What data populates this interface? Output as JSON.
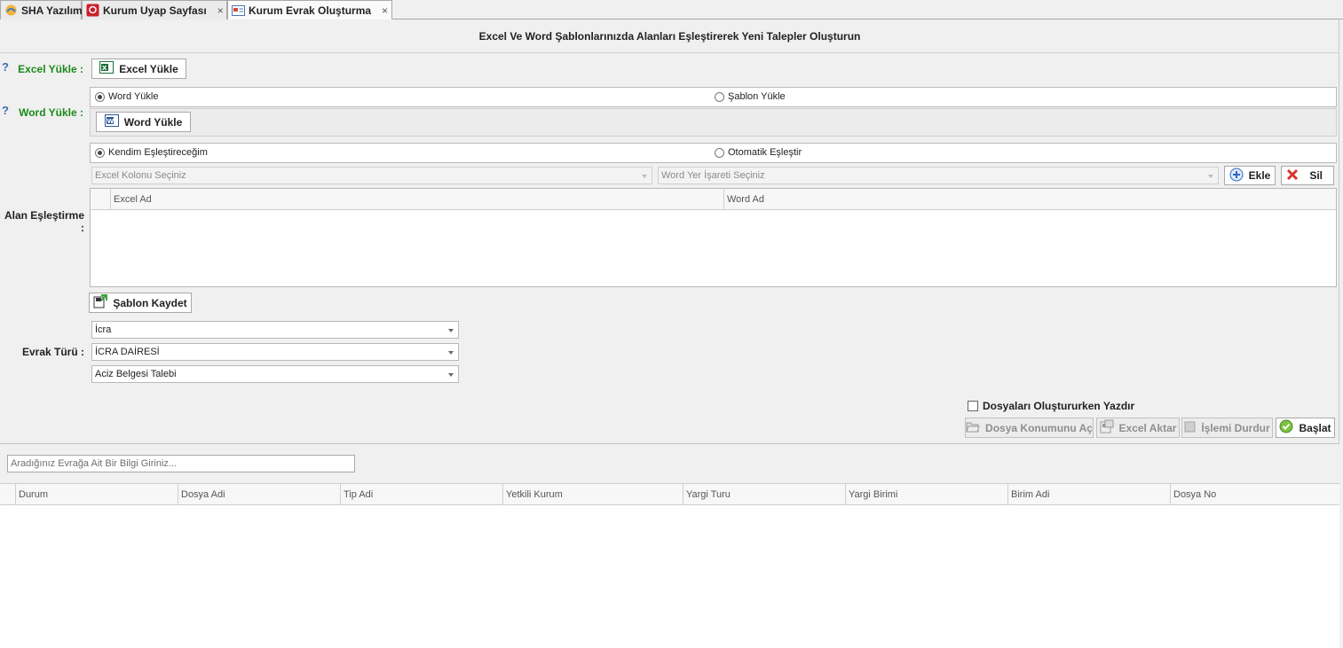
{
  "tabs": [
    {
      "label": "SHA Yazılım",
      "icon": "sha-logo-icon"
    },
    {
      "label": "Kurum Uyap Sayfası",
      "icon": "uyap-logo-icon",
      "close": "×"
    },
    {
      "label": "Kurum Evrak Oluşturma",
      "icon": "document-form-icon",
      "close": "×"
    }
  ],
  "header": {
    "title": "Excel Ve Word Şablonlarınızda Alanları Eşleştirerek Yeni Talepler Oluşturun"
  },
  "excel": {
    "label": "Excel Yükle :",
    "button": "Excel Yükle"
  },
  "word": {
    "label": "Word Yükle :",
    "radio_word": "Word Yükle",
    "radio_template": "Şablon Yükle",
    "button": "Word Yükle"
  },
  "mapping": {
    "label": "Alan Eşleştirme :",
    "radio_manual": "Kendim Eşleştireceğim",
    "radio_auto": "Otomatik Eşleştir",
    "excel_combo_placeholder": "Excel Kolonu Seçiniz",
    "word_combo_placeholder": "Word Yer İşareti Seçiniz",
    "add_button": "Ekle",
    "delete_button": "Sil",
    "columns": [
      "Excel Ad",
      "Word Ad"
    ]
  },
  "save_template_button": "Şablon Kaydet",
  "document_type": {
    "label": "Evrak Türü :",
    "combo1": "İcra",
    "combo2": "İCRA DAİRESİ",
    "combo3": "Aciz Belgesi Talebi"
  },
  "print_checkbox": "Dosyaları Oluştururken Yazdır",
  "actions": {
    "open_location": "Dosya Konumunu Aç",
    "excel_export": "Excel Aktar",
    "stop": "İşlemi Durdur",
    "start": "Başlat"
  },
  "search": {
    "placeholder": "Aradığınız Evrağa Ait Bir Bilgi Giriniz..."
  },
  "results_columns": [
    "Durum",
    "Dosya Adi",
    "Tip Adi",
    "Yetkili Kurum",
    "Yargi Turu",
    "Yargi Birimi",
    "Birim Adi",
    "Dosya No"
  ]
}
